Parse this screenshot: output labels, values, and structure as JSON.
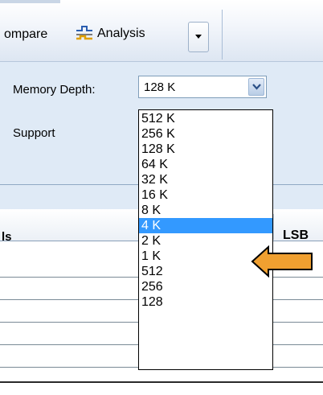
{
  "toolbar": {
    "compare_label": "ompare",
    "analysis_label": "Analysis"
  },
  "settings": {
    "memory_depth_label": "Memory Depth:",
    "memory_depth_value": "128 K",
    "support_label": "Support"
  },
  "dropdown": {
    "options": [
      "512 K",
      "256 K",
      "128 K",
      "64 K",
      "32 K",
      "16 K",
      "8 K",
      "4 K",
      "2 K",
      "1 K",
      "512",
      "256",
      "128"
    ],
    "highlighted": "4 K"
  },
  "table": {
    "columns": [
      "ls",
      "LSB"
    ]
  },
  "colors": {
    "highlight": "#3399ff",
    "arrow_fill": "#f0a030",
    "panel_bg": "#dfeaf6"
  }
}
